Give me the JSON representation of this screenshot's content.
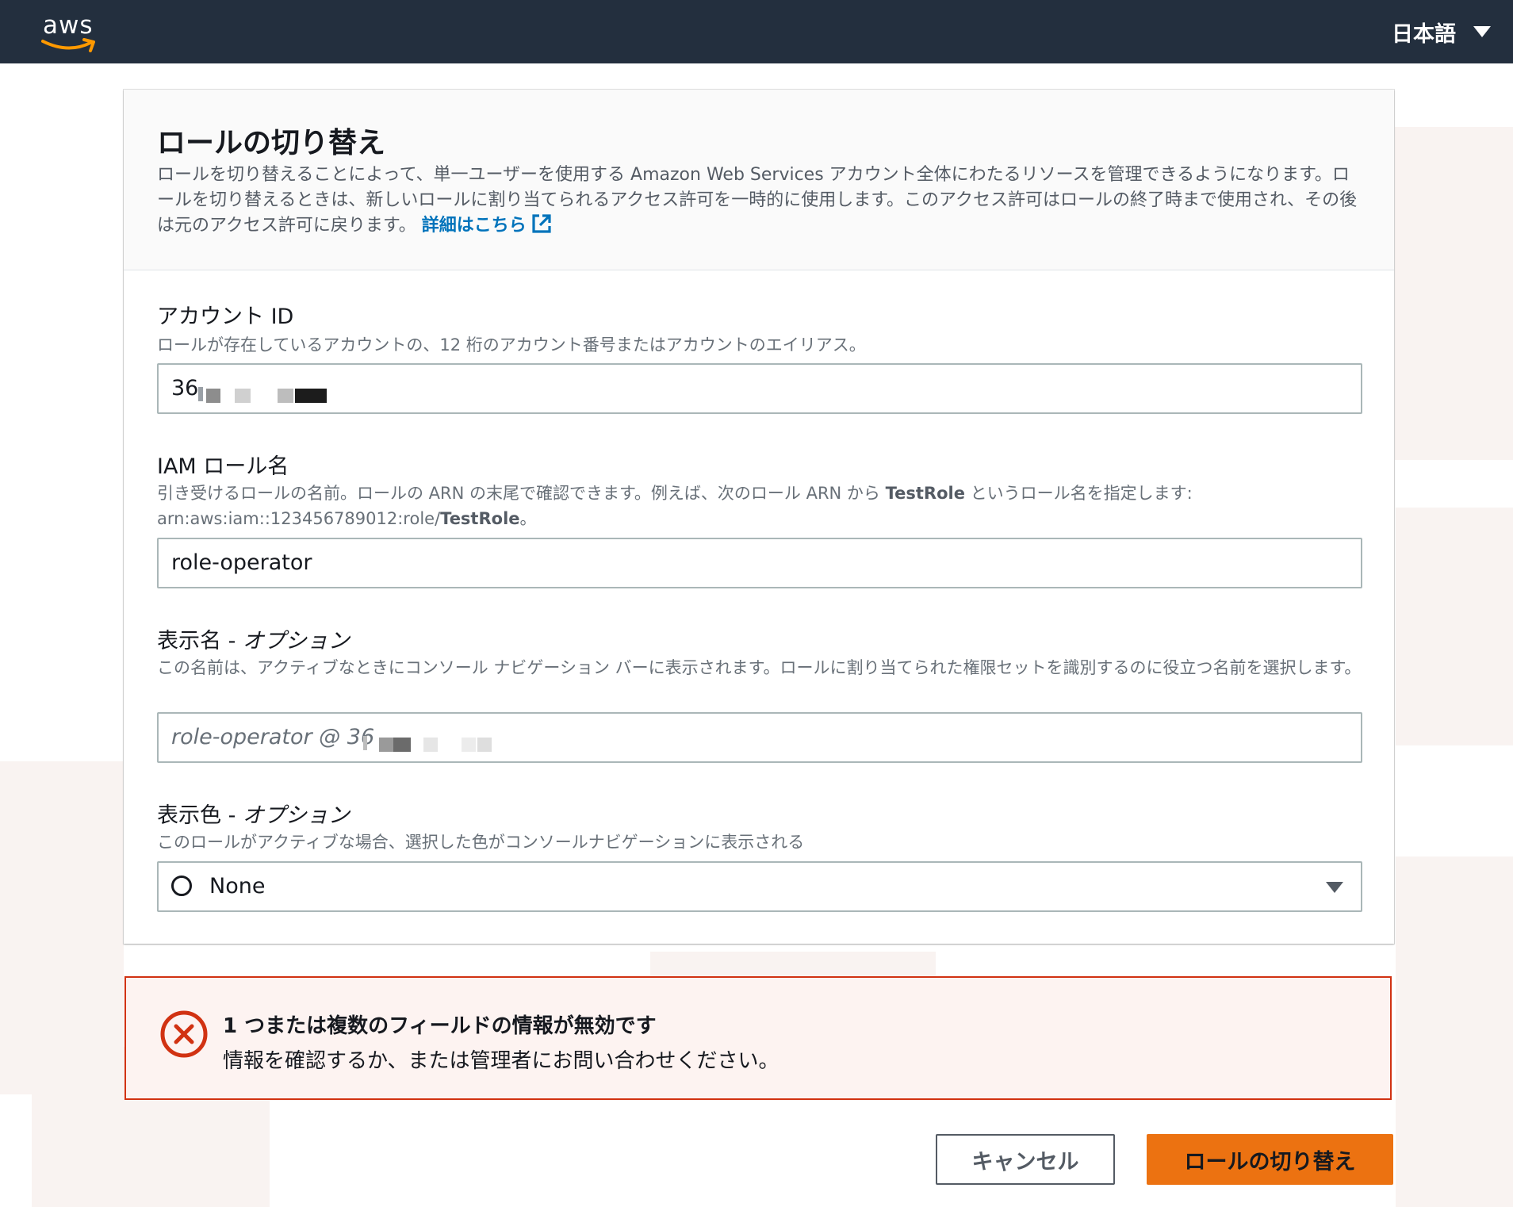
{
  "topbar": {
    "logo_text": "aws",
    "language": "日本語"
  },
  "card": {
    "title": "ロールの切り替え",
    "description": "ロールを切り替えることによって、単一ユーザーを使用する Amazon Web Services アカウント全体にわたるリソースを管理できるようになります。ロールを切り替えるときは、新しいロールに割り当てられるアクセス許可を一時的に使用します。このアクセス許可はロールの終了時まで使用され、その後は元のアクセス許可に戻ります。",
    "learn_more": "詳細はこちら"
  },
  "account_id": {
    "label": "アカウント ID",
    "description": "ロールが存在しているアカウントの、12 桁のアカウント番号またはアカウントのエイリアス。",
    "value": "36"
  },
  "role_name": {
    "label": "IAM ロール名",
    "description_pre": "引き受けるロールの名前。ロールの ARN の末尾で確認できます。例えば、次のロール ARN から ",
    "description_bold": "TestRole",
    "description_mid": " というロール名を指定します: arn:aws:iam::123456789012:role/",
    "description_bold2": "TestRole",
    "description_end": "。",
    "value": "role-operator"
  },
  "display_name": {
    "label": "表示名 - ",
    "label_optional": "オプション",
    "description": "この名前は、アクティブなときにコンソール ナビゲーション バーに表示されます。ロールに割り当てられた権限セットを識別するのに役立つ名前を選択します。",
    "placeholder": "role-operator @ 36"
  },
  "display_color": {
    "label": "表示色 - ",
    "label_optional": "オプション",
    "description": "このロールがアクティブな場合、選択した色がコンソールナビゲーションに表示される",
    "selected": "None"
  },
  "alert": {
    "title": "1 つまたは複数のフィールドの情報が無効です",
    "body": "情報を確認するか、または管理者にお問い合わせください。",
    "color": "#d13212"
  },
  "actions": {
    "cancel_label": "キャンセル",
    "switch_label": "ロールの切り替え",
    "primary_color": "#ec7211"
  }
}
